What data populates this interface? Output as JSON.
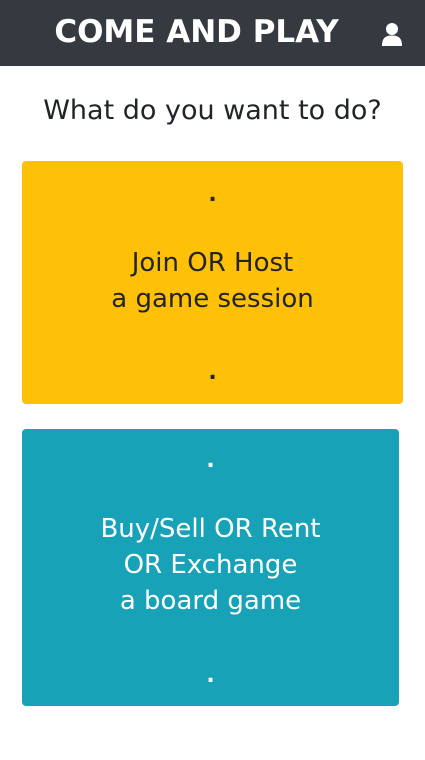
{
  "header": {
    "title": "COME AND PLAY",
    "user_icon": "user-icon"
  },
  "prompt": "What do you want to do?",
  "cards": [
    {
      "marker_top": ".",
      "lines": [
        "Join OR Host",
        "a game session"
      ],
      "marker_bottom": ".",
      "color": "#ffc107"
    },
    {
      "marker_top": ".",
      "lines": [
        "Buy/Sell OR Rent",
        "OR Exchange",
        "a board game"
      ],
      "marker_bottom": ".",
      "color": "#17a2b8"
    }
  ],
  "colors": {
    "header_bg": "#343a40",
    "header_text": "#ffffff",
    "text_dark": "#212529"
  }
}
